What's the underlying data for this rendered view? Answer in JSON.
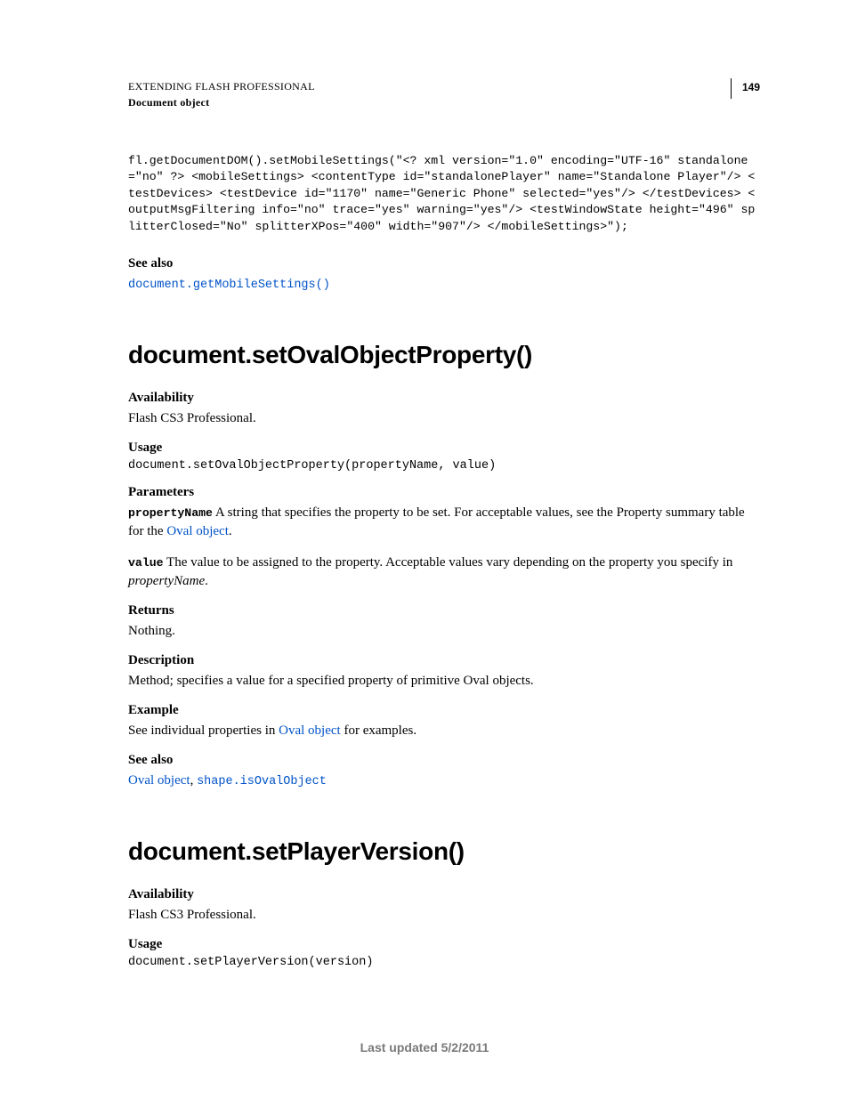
{
  "header": {
    "book": "EXTENDING FLASH PROFESSIONAL",
    "chapter": "Document object",
    "pageNumber": "149"
  },
  "topCode": "fl.getDocumentDOM().setMobileSettings(\"<? xml version=\"1.0\" encoding=\"UTF-16\" standalone=\"no\" ?> <mobileSettings> <contentType id=\"standalonePlayer\" name=\"Standalone Player\"/> <testDevices> <testDevice id=\"1170\" name=\"Generic Phone\" selected=\"yes\"/> </testDevices> <outputMsgFiltering info=\"no\" trace=\"yes\" warning=\"yes\"/> <testWindowState height=\"496\" splitterClosed=\"No\" splitterXPos=\"400\" width=\"907\"/> </mobileSettings>\");",
  "topSeeAlso": {
    "label": "See also",
    "link": "document.getMobileSettings()"
  },
  "method1": {
    "title": "document.setOvalObjectProperty()",
    "availabilityLabel": "Availability",
    "availabilityText": "Flash CS3 Professional.",
    "usageLabel": "Usage",
    "usageCode": "document.setOvalObjectProperty(propertyName, value)",
    "parametersLabel": "Parameters",
    "param1Name": "propertyName",
    "param1TextA": "  A string that specifies the property to be set. For acceptable values, see the Property summary table for the ",
    "param1Link": "Oval object",
    "param1TextB": ".",
    "param2Name": "value",
    "param2TextA": "  The value to be assigned to the property. Acceptable values vary depending on the property you specify in ",
    "param2Italic": "propertyName",
    "param2TextB": ".",
    "returnsLabel": "Returns",
    "returnsText": "Nothing.",
    "descriptionLabel": "Description",
    "descriptionText": "Method; specifies a value for a specified property of primitive Oval objects.",
    "exampleLabel": "Example",
    "exampleTextA": "See individual properties in ",
    "exampleLink": "Oval object",
    "exampleTextB": " for examples.",
    "seeAlsoLabel": "See also",
    "seeAlsoLink1": "Oval object",
    "seeAlsoSep": ", ",
    "seeAlsoLink2": "shape.isOvalObject"
  },
  "method2": {
    "title": "document.setPlayerVersion()",
    "availabilityLabel": "Availability",
    "availabilityText": "Flash CS3 Professional.",
    "usageLabel": "Usage",
    "usageCode": "document.setPlayerVersion(version)"
  },
  "footer": "Last updated 5/2/2011"
}
